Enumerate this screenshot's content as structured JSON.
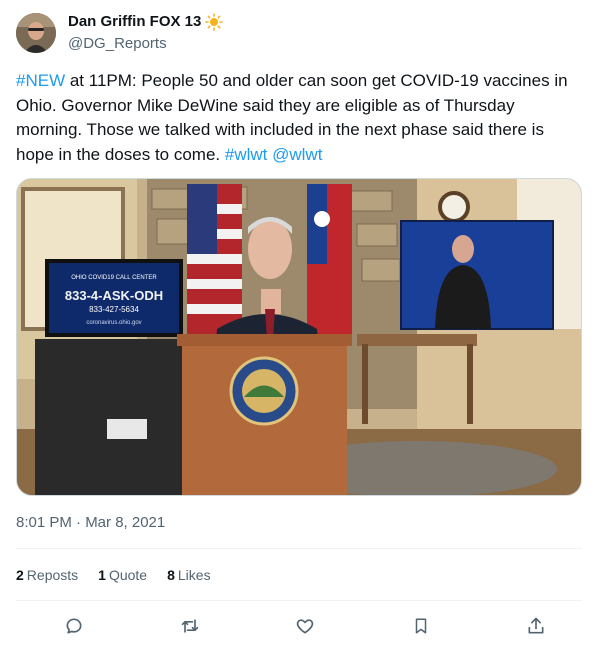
{
  "author": {
    "display_name": "Dan Griffin FOX 13",
    "handle": "@DG_Reports",
    "badge_icon": "sun-icon"
  },
  "tweet": {
    "hashtag_new": "#NEW",
    "text": " at 11PM: People 50 and older can soon get COVID-19 vaccines in Ohio. Governor Mike DeWine said they are eligible as of Thursday morning. Those we talked with included in the next phase said there is hope in the doses to come. ",
    "hashtag_wlwt": "#wlwt",
    "mention_wlwt": "@wlwt"
  },
  "media": {
    "screen_line1": "OHIO COVID19 CALL CENTER",
    "screen_line2": "833-4-ASK-ODH",
    "screen_line3": "833-427-5634",
    "screen_line4": "coronavirus.ohio.gov"
  },
  "timestamp": "8:01 PM · Mar 8, 2021",
  "stats": {
    "reposts_count": "2",
    "reposts_label": "Reposts",
    "quotes_count": "1",
    "quotes_label": "Quote",
    "likes_count": "8",
    "likes_label": "Likes"
  },
  "colors": {
    "link": "#1d9bf0",
    "secondary_text": "#536471",
    "icon": "#536471"
  },
  "actions": [
    "reply-icon",
    "retweet-icon",
    "like-icon",
    "bookmark-icon",
    "share-icon"
  ]
}
